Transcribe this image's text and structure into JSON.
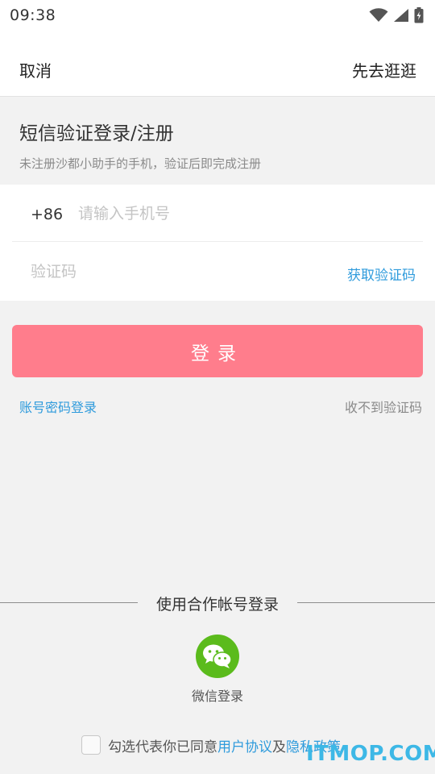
{
  "status_bar": {
    "time": "09:38",
    "icons": [
      "wifi-icon",
      "signal-icon",
      "battery-charging-icon"
    ]
  },
  "nav": {
    "cancel_label": "取消",
    "browse_label": "先去逛逛"
  },
  "header": {
    "title": "短信验证登录/注册",
    "subtitle": "未注册沙都小助手的手机，验证后即完成注册"
  },
  "form": {
    "country_code": "+86",
    "phone_placeholder": "请输入手机号",
    "code_placeholder": "验证码",
    "get_code_label": "获取验证码"
  },
  "login_button_label": "登录",
  "links": {
    "password_login": "账号密码登录",
    "no_code": "收不到验证码"
  },
  "third_party": {
    "divider_text": "使用合作帐号登录",
    "wechat_label": "微信登录"
  },
  "agreement": {
    "prefix": "勾选代表你已同意",
    "user_agreement": "用户协议",
    "and": "及",
    "privacy_policy": "隐私政策"
  },
  "watermark": "ITMOP.COM",
  "colors": {
    "accent_blue": "#2f9bdc",
    "login_pink": "#ff7d8c",
    "wechat_green": "#5bbb1c",
    "watermark_blue": "#3db8e6"
  }
}
